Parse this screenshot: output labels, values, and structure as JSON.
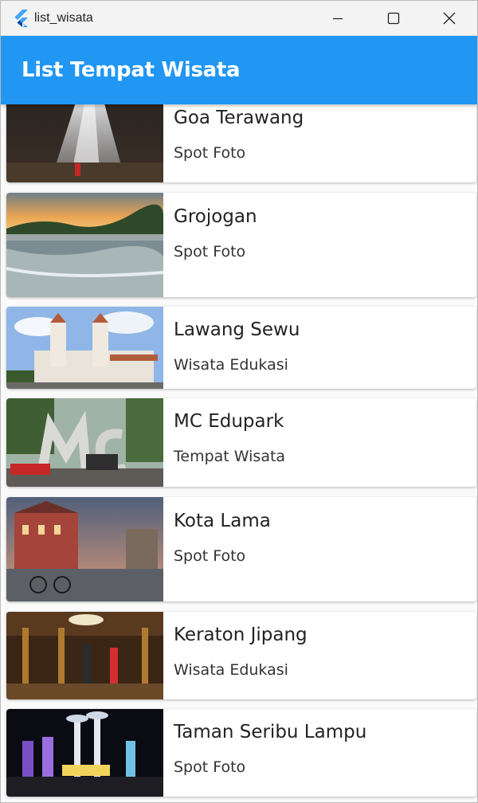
{
  "window": {
    "title": "list_wisata"
  },
  "appbar": {
    "title": "List Tempat Wisata",
    "color": "#2196f3"
  },
  "items": [
    {
      "title": "Goa Terawang",
      "subtitle": "Spot Foto",
      "image": "cave-light-beams-photo"
    },
    {
      "title": "Grojogan",
      "subtitle": "Spot Foto",
      "image": "river-weir-sunset-photo"
    },
    {
      "title": "Lawang Sewu",
      "subtitle": "Wisata Edukasi",
      "image": "colonial-building-photo"
    },
    {
      "title": "MC Edupark",
      "subtitle": "Tempat Wisata",
      "image": "park-entrance-sign-photo"
    },
    {
      "title": "Kota Lama",
      "subtitle": "Spot Foto",
      "image": "old-town-street-photo"
    },
    {
      "title": "Keraton Jipang",
      "subtitle": "Wisata Edukasi",
      "image": "pendopo-ceremony-photo"
    },
    {
      "title": "Taman Seribu Lampu",
      "subtitle": "Spot Foto",
      "image": "night-light-park-photo"
    }
  ]
}
